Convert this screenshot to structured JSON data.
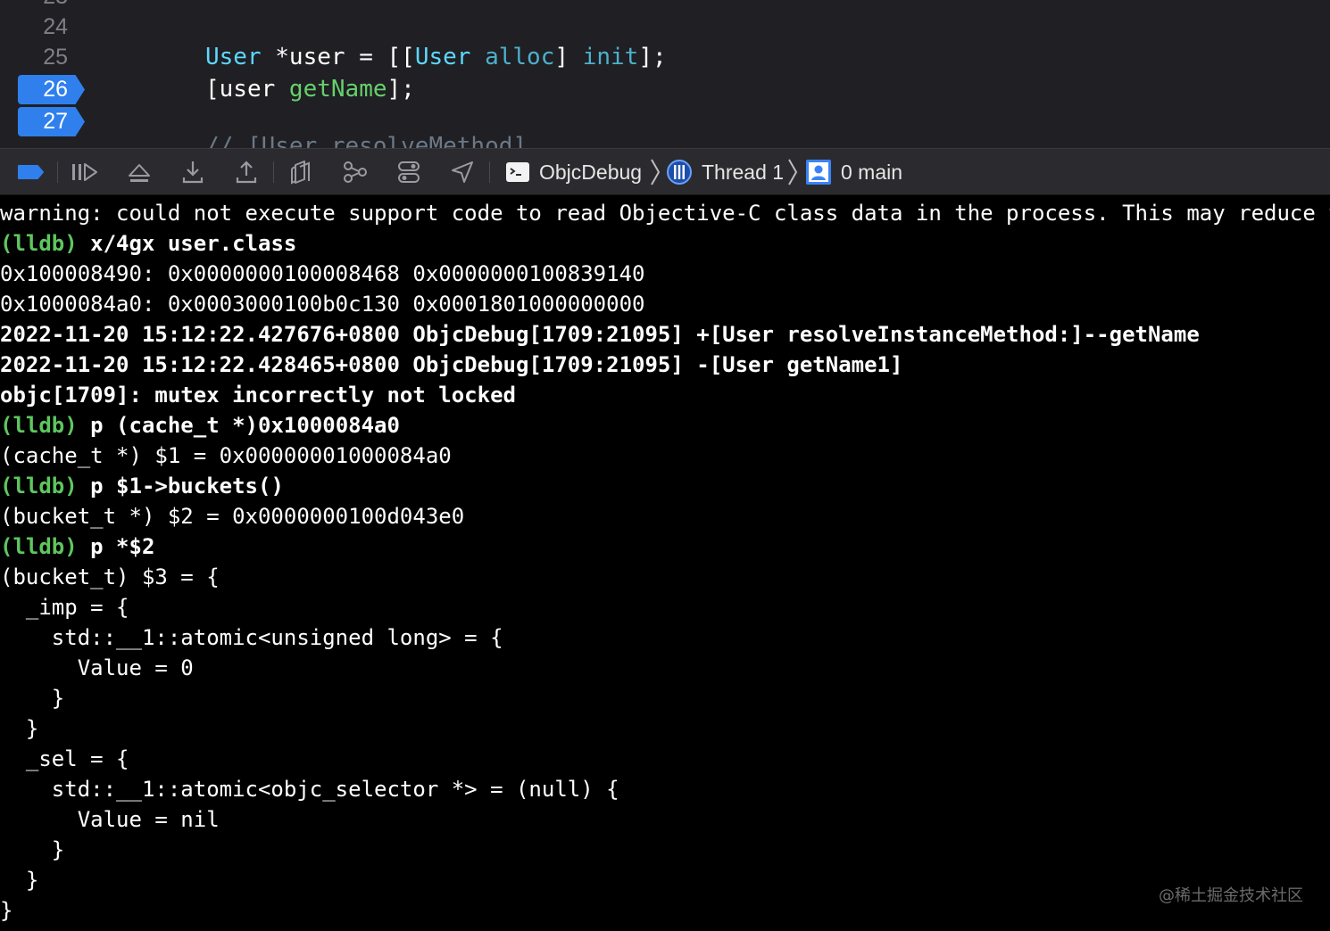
{
  "editor": {
    "lines": [
      {
        "number": "24",
        "code": ""
      },
      {
        "number": "25",
        "code": "User *user = [[User alloc] init];"
      },
      {
        "number": "26",
        "code": "[user getName];"
      },
      {
        "number": "27",
        "code": ""
      }
    ],
    "code_line_25": {
      "type1": "User",
      "var": " *user = [[",
      "type2": "User",
      "sp": " ",
      "alloc": "alloc",
      "br": "] ",
      "init": "init",
      "end": "];"
    },
    "code_line_26": {
      "open": "[user ",
      "method": "getName",
      "end": "];"
    },
    "partial_comment": "// [User resolveMethod]"
  },
  "debugbar": {
    "target": "ObjcDebug",
    "thread": "Thread 1",
    "frame": "0 main"
  },
  "console": {
    "lines": [
      {
        "prompt": "",
        "text": "warning: could not execute support code to read Objective-C class data in the process. This may reduce the quality of type information available.",
        "bold": false
      },
      {
        "prompt": "(lldb)",
        "text": " x/4gx user.class",
        "bold": true
      },
      {
        "prompt": "",
        "text": "0x100008490: 0x0000000100008468 0x0000000100839140",
        "bold": false
      },
      {
        "prompt": "",
        "text": "0x1000084a0: 0x0003000100b0c130 0x0001801000000000",
        "bold": false
      },
      {
        "prompt": "",
        "text": "2022-11-20 15:12:22.427676+0800 ObjcDebug[1709:21095] +[User resolveInstanceMethod:]--getName",
        "bold": true
      },
      {
        "prompt": "",
        "text": "2022-11-20 15:12:22.428465+0800 ObjcDebug[1709:21095] -[User getName1]",
        "bold": true
      },
      {
        "prompt": "",
        "text": "objc[1709]: mutex incorrectly not locked",
        "bold": true
      },
      {
        "prompt": "(lldb)",
        "text": " p (cache_t *)0x1000084a0",
        "bold": true
      },
      {
        "prompt": "",
        "text": "(cache_t *) $1 = 0x00000001000084a0",
        "bold": false
      },
      {
        "prompt": "(lldb)",
        "text": " p $1->buckets()",
        "bold": true
      },
      {
        "prompt": "",
        "text": "(bucket_t *) $2 = 0x0000000100d043e0",
        "bold": false
      },
      {
        "prompt": "(lldb)",
        "text": " p *$2",
        "bold": true
      },
      {
        "prompt": "",
        "text": "(bucket_t) $3 = {",
        "bold": false
      },
      {
        "prompt": "",
        "text": "  _imp = {",
        "bold": false
      },
      {
        "prompt": "",
        "text": "    std::__1::atomic<unsigned long> = {",
        "bold": false
      },
      {
        "prompt": "",
        "text": "      Value = 0",
        "bold": false
      },
      {
        "prompt": "",
        "text": "    }",
        "bold": false
      },
      {
        "prompt": "",
        "text": "  }",
        "bold": false
      },
      {
        "prompt": "",
        "text": "  _sel = {",
        "bold": false
      },
      {
        "prompt": "",
        "text": "    std::__1::atomic<objc_selector *> = (null) {",
        "bold": false
      },
      {
        "prompt": "",
        "text": "      Value = nil",
        "bold": false
      },
      {
        "prompt": "",
        "text": "    }",
        "bold": false
      },
      {
        "prompt": "",
        "text": "  }",
        "bold": false
      },
      {
        "prompt": "",
        "text": "}",
        "bold": false
      }
    ]
  },
  "watermark": "@稀土掘金技术社区",
  "colors": {
    "breakpoint": "#2f80ed",
    "prompt": "#5ec65e",
    "type": "#5dd8ff",
    "method_green": "#67d06b",
    "debugbar_bg": "#2b2b2f"
  }
}
